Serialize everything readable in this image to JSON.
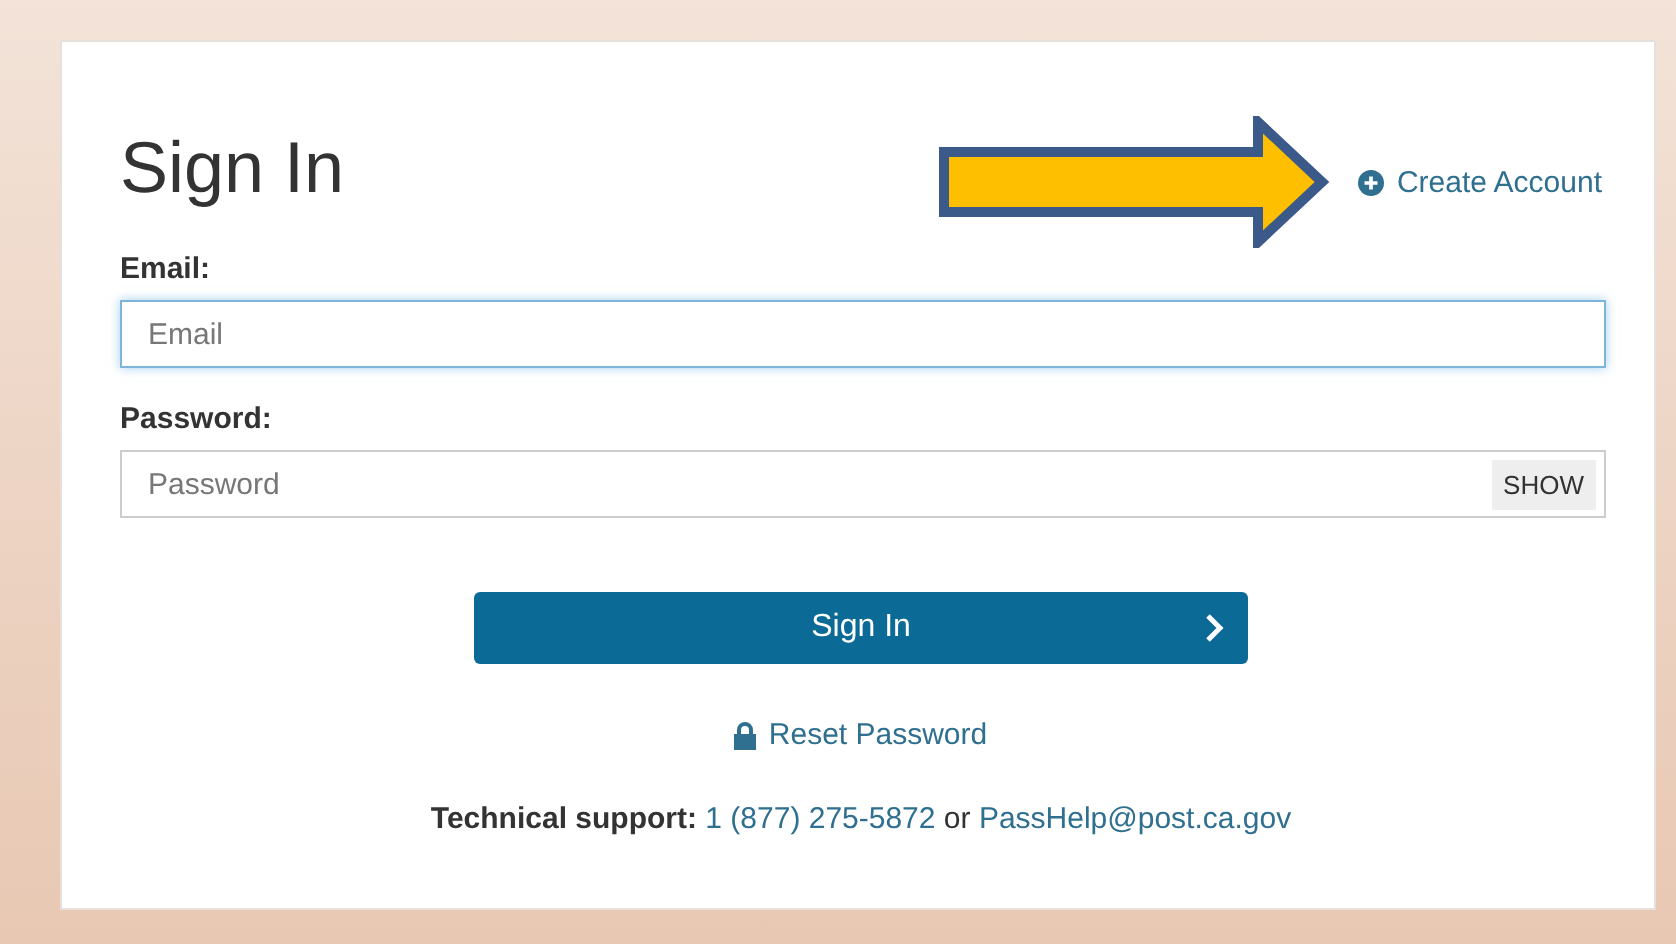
{
  "title": "Sign In",
  "create_account": {
    "label": "Create Account"
  },
  "fields": [
    {
      "label": "Email:",
      "placeholder": "Email",
      "focused": true
    },
    {
      "label": "Password:",
      "placeholder": "Password",
      "focused": false,
      "toggle": "SHOW"
    }
  ],
  "submit": {
    "label": "Sign In"
  },
  "reset": {
    "label": "Reset Password"
  },
  "support": {
    "label": "Technical support:",
    "phone": "1 (877) 275-5872",
    "separator": "or",
    "email": "PassHelp@post.ca.gov"
  }
}
